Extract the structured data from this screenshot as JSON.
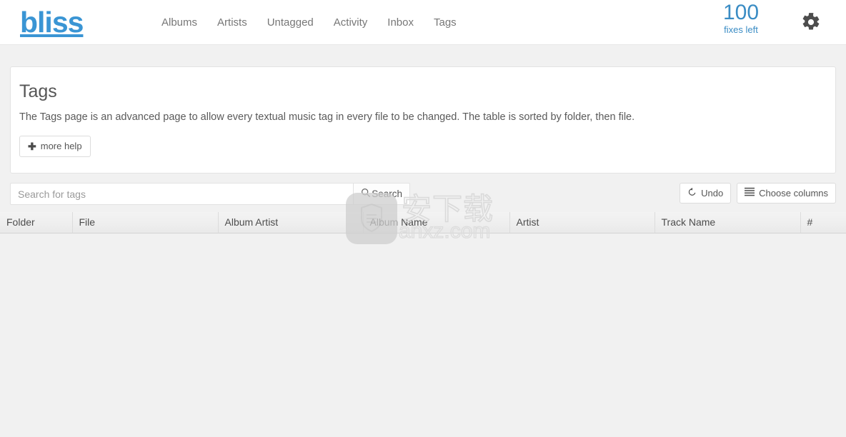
{
  "navbar": {
    "brand": "bliss",
    "links": [
      {
        "label": "Albums",
        "name": "albums"
      },
      {
        "label": "Artists",
        "name": "artists"
      },
      {
        "label": "Untagged",
        "name": "untagged"
      },
      {
        "label": "Activity",
        "name": "activity"
      },
      {
        "label": "Inbox",
        "name": "inbox"
      },
      {
        "label": "Tags",
        "name": "tags"
      }
    ],
    "fixes": {
      "count": "100",
      "label": "fixes left"
    },
    "settings_icon": "gear-icon",
    "brand_color": "#3a95d4",
    "accent_color": "#3a8cc4"
  },
  "panel": {
    "title": "Tags",
    "description": "The Tags page is an advanced page to allow every textual music tag in every file to be changed. The table is sorted by folder, then file.",
    "more_help_label": "more help",
    "more_help_icon": "plus-icon"
  },
  "search": {
    "placeholder": "Search for tags",
    "value": "",
    "button_label": "Search",
    "button_icon": "search-icon"
  },
  "toolbar": {
    "undo_label": "Undo",
    "undo_icon": "undo-arrow-icon",
    "choose_columns_label": "Choose columns",
    "choose_columns_icon": "list-icon"
  },
  "table": {
    "columns": [
      {
        "label": "Folder"
      },
      {
        "label": "File"
      },
      {
        "label": "Album Artist"
      },
      {
        "label": "Album Name"
      },
      {
        "label": "Artist"
      },
      {
        "label": "Track Name"
      },
      {
        "label": "#"
      }
    ],
    "rows": []
  },
  "watermark": {
    "badge_icon": "shield-app-icon",
    "cn_text": "安下载",
    "url_text": "anxz.com"
  }
}
